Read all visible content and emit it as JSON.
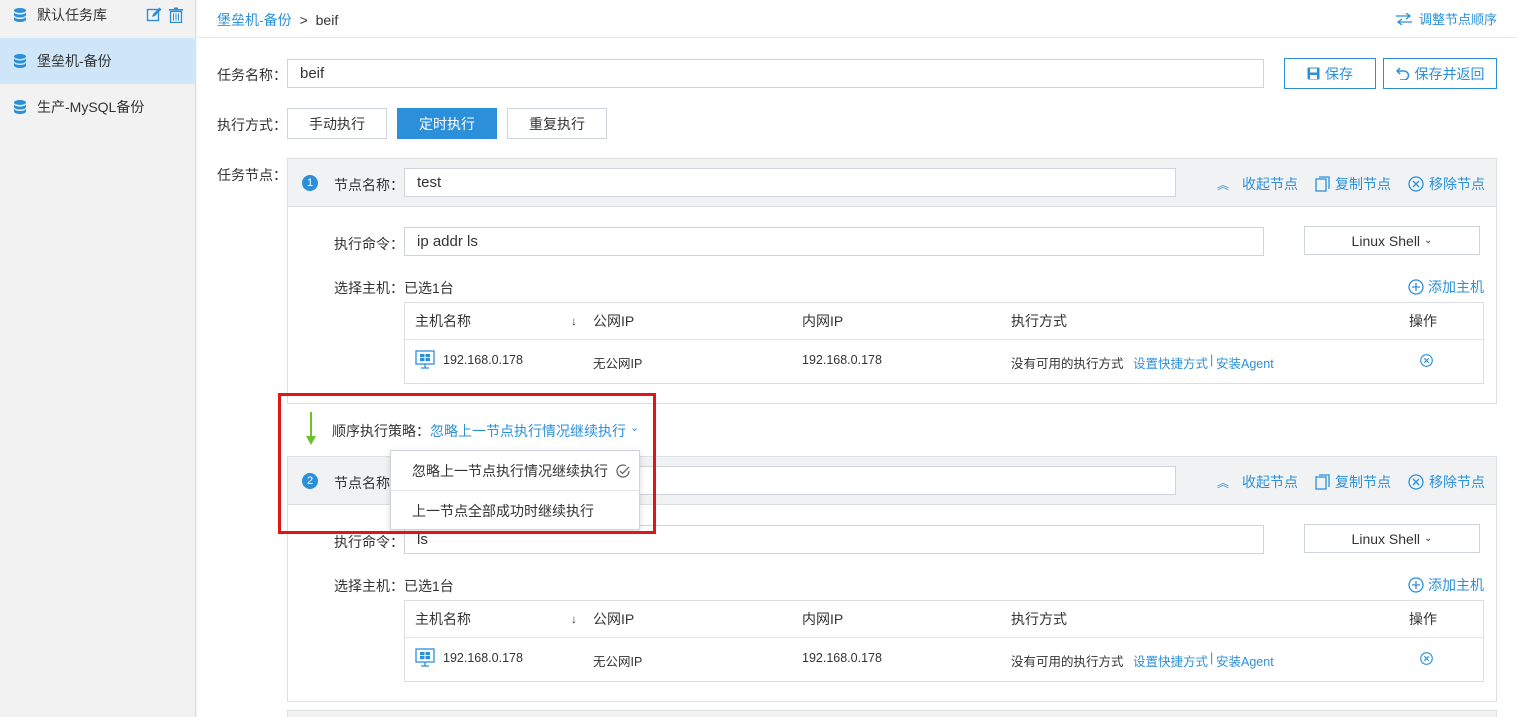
{
  "sidebar": {
    "items": [
      {
        "label": "默认任务库"
      },
      {
        "label": "堡垒机-备份"
      },
      {
        "label": "生产-MySQL备份"
      }
    ]
  },
  "breadcrumb": {
    "parent": "堡垒机-备份",
    "separator": ">",
    "current": "beif"
  },
  "header": {
    "reorder_label": "调整节点顺序"
  },
  "form": {
    "task_name_label": "任务名称：",
    "task_name_value": "beif",
    "save_label": "保存",
    "save_return_label": "保存并返回",
    "exec_mode_label": "执行方式：",
    "exec_modes": [
      "手动执行",
      "定时执行",
      "重复执行"
    ],
    "exec_mode_selected": "定时执行",
    "task_nodes_label": "任务节点："
  },
  "nodes": [
    {
      "number": "1",
      "name_label": "节点名称：",
      "name_value": "test",
      "collapse_label": "收起节点",
      "copy_label": "复制节点",
      "remove_label": "移除节点",
      "cmd_label": "执行命令：",
      "cmd_value": "ip addr ls",
      "shell": "Linux Shell",
      "hosts_label": "选择主机：已选1台",
      "add_host_label": "添加主机",
      "columns": [
        "主机名称",
        "公网IP",
        "内网IP",
        "执行方式",
        "操作"
      ],
      "rows": [
        {
          "host": "192.168.0.178",
          "public_ip": "无公网IP",
          "private_ip": "192.168.0.178",
          "exec": "没有可用的执行方式",
          "action_a": "设置快捷方式",
          "sep": "|",
          "action_b": "安装Agent"
        }
      ]
    },
    {
      "number": "2",
      "name_label": "节点名称",
      "name_value": "",
      "collapse_label": "收起节点",
      "copy_label": "复制节点",
      "remove_label": "移除节点",
      "cmd_label": "执行命令：",
      "cmd_value": "ls",
      "shell": "Linux Shell",
      "hosts_label": "选择主机：已选1台",
      "add_host_label": "添加主机",
      "columns": [
        "主机名称",
        "公网IP",
        "内网IP",
        "执行方式",
        "操作"
      ],
      "rows": [
        {
          "host": "192.168.0.178",
          "public_ip": "无公网IP",
          "private_ip": "192.168.0.178",
          "exec": "没有可用的执行方式",
          "action_a": "设置快捷方式",
          "sep": "|",
          "action_b": "安装Agent"
        }
      ]
    }
  ],
  "strategy": {
    "label": "顺序执行策略：",
    "value": "忽略上一节点执行情况继续执行",
    "options": [
      "忽略上一节点执行情况继续执行",
      "上一节点全部成功时继续执行"
    ]
  },
  "colors": {
    "accent": "#2b90d9",
    "highlight": "#e01515",
    "arrow": "#6cc12c"
  }
}
